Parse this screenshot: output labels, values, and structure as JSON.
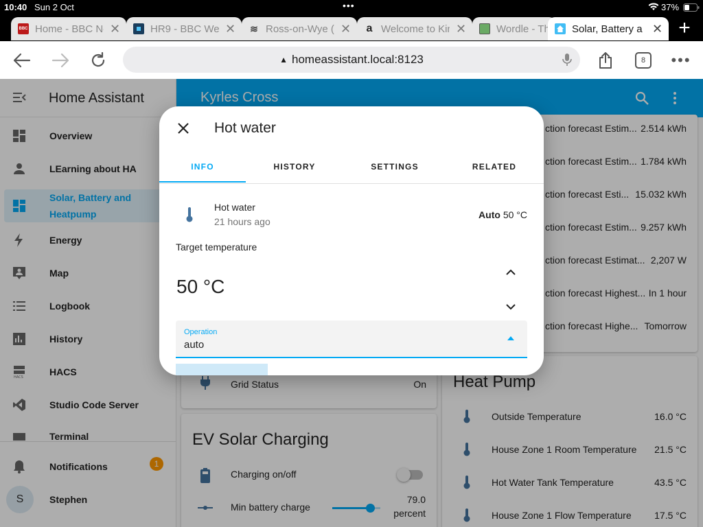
{
  "status_bar": {
    "time": "10:40",
    "date": "Sun 2 Oct",
    "battery": "37%"
  },
  "browser": {
    "tabs": [
      {
        "label": "Home - BBC Ne",
        "favicon": "bbc-news-icon"
      },
      {
        "label": "HR9 - BBC Wea",
        "favicon": "bbc-weather-icon"
      },
      {
        "label": "Ross-on-Wye (",
        "favicon": "weather-waves-icon"
      },
      {
        "label": "Welcome to Kin",
        "favicon": "amazon-icon"
      },
      {
        "label": "Wordle - Th",
        "favicon": "wordle-icon"
      },
      {
        "label": "Solar, Battery a",
        "favicon": "home-assistant-icon"
      }
    ],
    "address": "homeassistant.local:8123",
    "tab_count": "8"
  },
  "sidebar": {
    "title": "Home Assistant",
    "items": [
      {
        "label": "Overview",
        "icon": "dashboard-icon"
      },
      {
        "label": "LEarning about HA",
        "icon": "person-icon"
      },
      {
        "label": "Solar, Battery and Heatpump",
        "icon": "dashboard-icon"
      },
      {
        "label": "Energy",
        "icon": "lightning-icon"
      },
      {
        "label": "Map",
        "icon": "map-account-icon"
      },
      {
        "label": "Logbook",
        "icon": "list-icon"
      },
      {
        "label": "History",
        "icon": "chart-icon"
      },
      {
        "label": "HACS",
        "icon": "hacs-icon"
      },
      {
        "label": "Studio Code Server",
        "icon": "vscode-icon"
      },
      {
        "label": "Terminal",
        "icon": "terminal-icon"
      }
    ],
    "notifications": {
      "label": "Notifications",
      "count": "1"
    },
    "user": {
      "label": "Stephen",
      "initial": "S"
    }
  },
  "header": {
    "title": "Kyrles Cross"
  },
  "forecast_rows": [
    {
      "label": "ction forecast Estim...",
      "value": "2.514 kWh"
    },
    {
      "label": "ction forecast Estim...",
      "value": "1.784 kWh"
    },
    {
      "label": "ction forecast Esti...",
      "value": "15.032 kWh"
    },
    {
      "label": "ction forecast Estim...",
      "value": "9.257 kWh"
    },
    {
      "label": "ction forecast Estimat...",
      "value": "2,207 W"
    },
    {
      "label": "ction forecast Highest...",
      "value": "In 1 hour"
    },
    {
      "label": "ction forecast Highe...",
      "value": "Tomorrow"
    }
  ],
  "grid_card": {
    "label": "Grid Status",
    "value": "On"
  },
  "ev_card": {
    "title": "EV Solar Charging",
    "charging_label": "Charging on/off",
    "min_battery_label": "Min battery charge",
    "min_battery_value": "79.0",
    "min_battery_unit": "percent",
    "slider_fraction": 0.79
  },
  "heat_pump_card": {
    "title": "Heat Pump",
    "rows": [
      {
        "label": "Outside Temperature",
        "value": "16.0 °C"
      },
      {
        "label": "House Zone 1 Room Temperature",
        "value": "21.5 °C"
      },
      {
        "label": "Hot Water Tank Temperature",
        "value": "43.5 °C"
      },
      {
        "label": "House Zone 1 Flow Temperature",
        "value": "17.5 °C"
      }
    ]
  },
  "dialog": {
    "title": "Hot water",
    "tabs": [
      "INFO",
      "HISTORY",
      "SETTINGS",
      "RELATED"
    ],
    "entity_name": "Hot water",
    "entity_time": "21 hours ago",
    "state_mode": "Auto",
    "state_temp": "50 °C",
    "target_label": "Target temperature",
    "target_value": "50 °C",
    "operation_label": "Operation",
    "operation_value": "auto"
  },
  "colors": {
    "accent": "#03a9f4",
    "thermometer": "#44739e",
    "badge": "#ff9800"
  }
}
